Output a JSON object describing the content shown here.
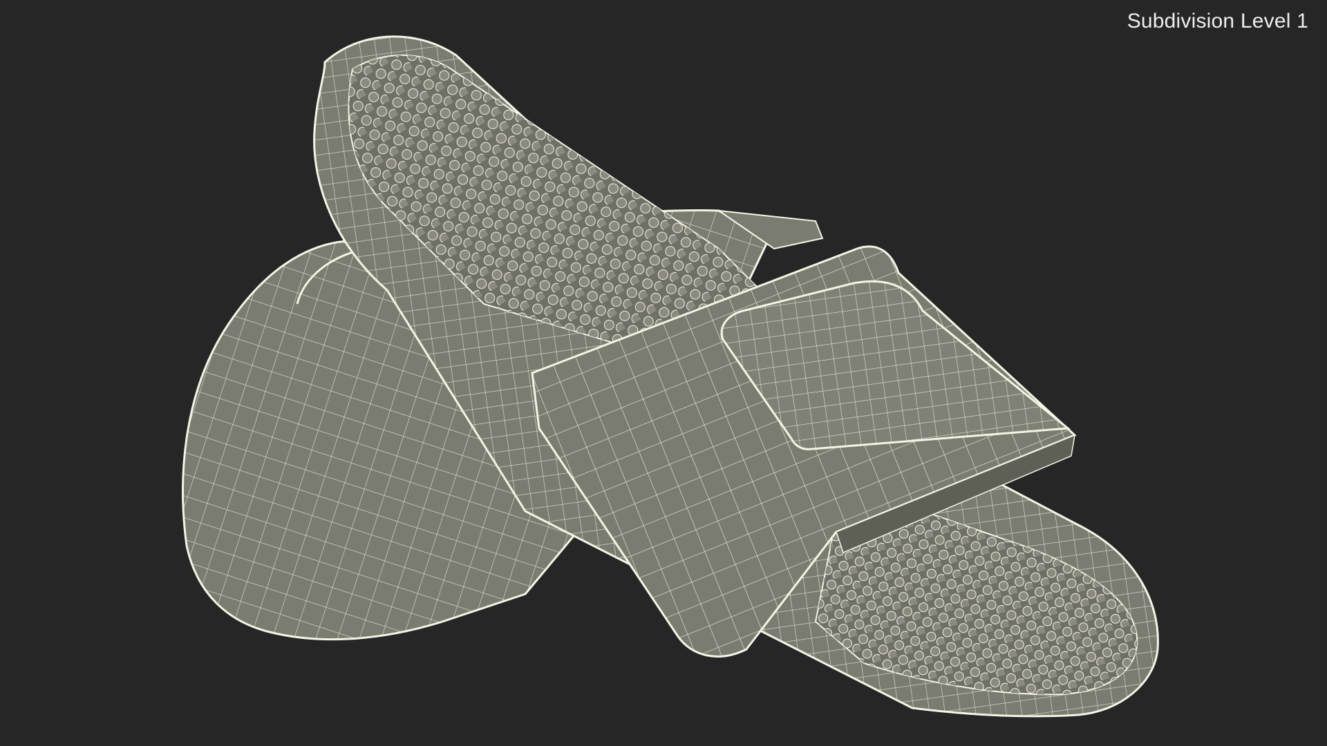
{
  "viewport": {
    "overlay_label": "Subdivision Level 1",
    "background_color": "#262626"
  },
  "render": {
    "surface_color": "#7b7c70",
    "wire_color": "#f4f4e6",
    "shadow_color": "#5f6055"
  }
}
